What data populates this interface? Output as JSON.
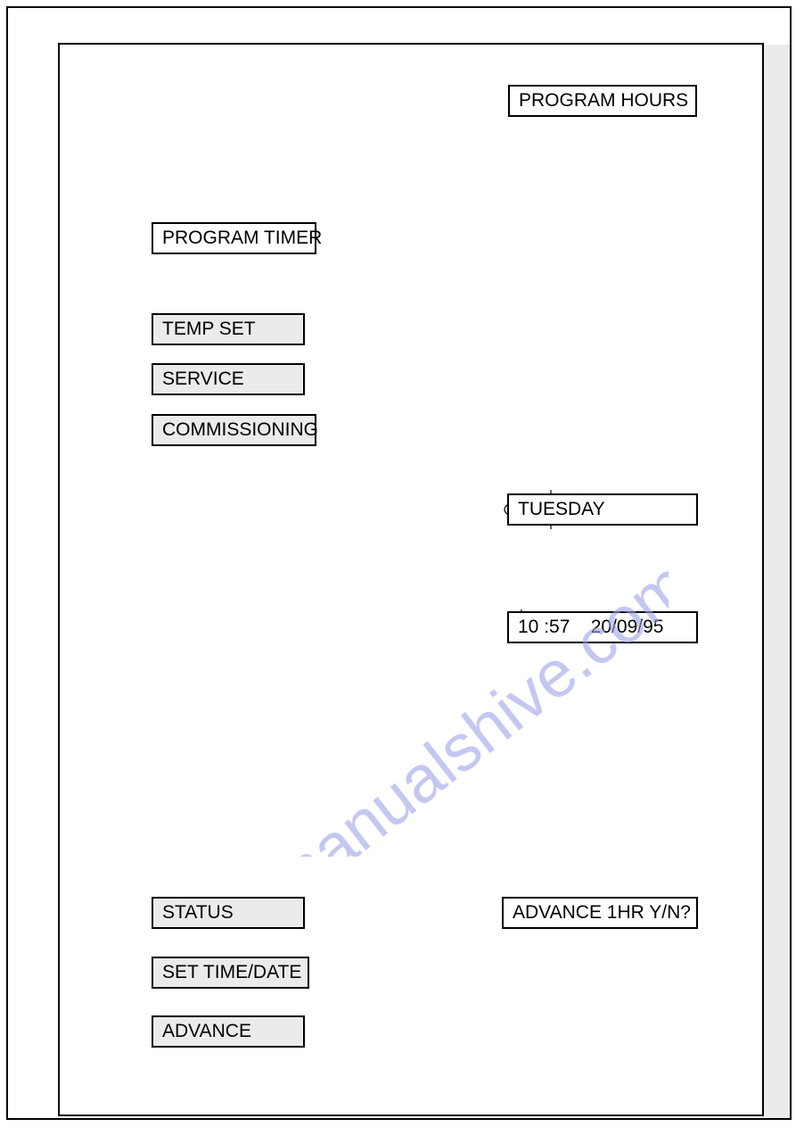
{
  "boxes": {
    "program_hours": "PROGRAM HOURS",
    "program_timer": "PROGRAM TIMER",
    "temp_set": "TEMP SET",
    "service": "SERVICE",
    "commissioning": "COMMISSIONING",
    "status": "STATUS",
    "set_time_date": "SET TIME/DATE",
    "advance": "ADVANCE"
  },
  "displays": {
    "day": "TUESDAY",
    "time_date": "10 :57    20/09/95",
    "advance_prompt": "ADVANCE 1HR Y/N?"
  },
  "watermark": "manualshive.com"
}
